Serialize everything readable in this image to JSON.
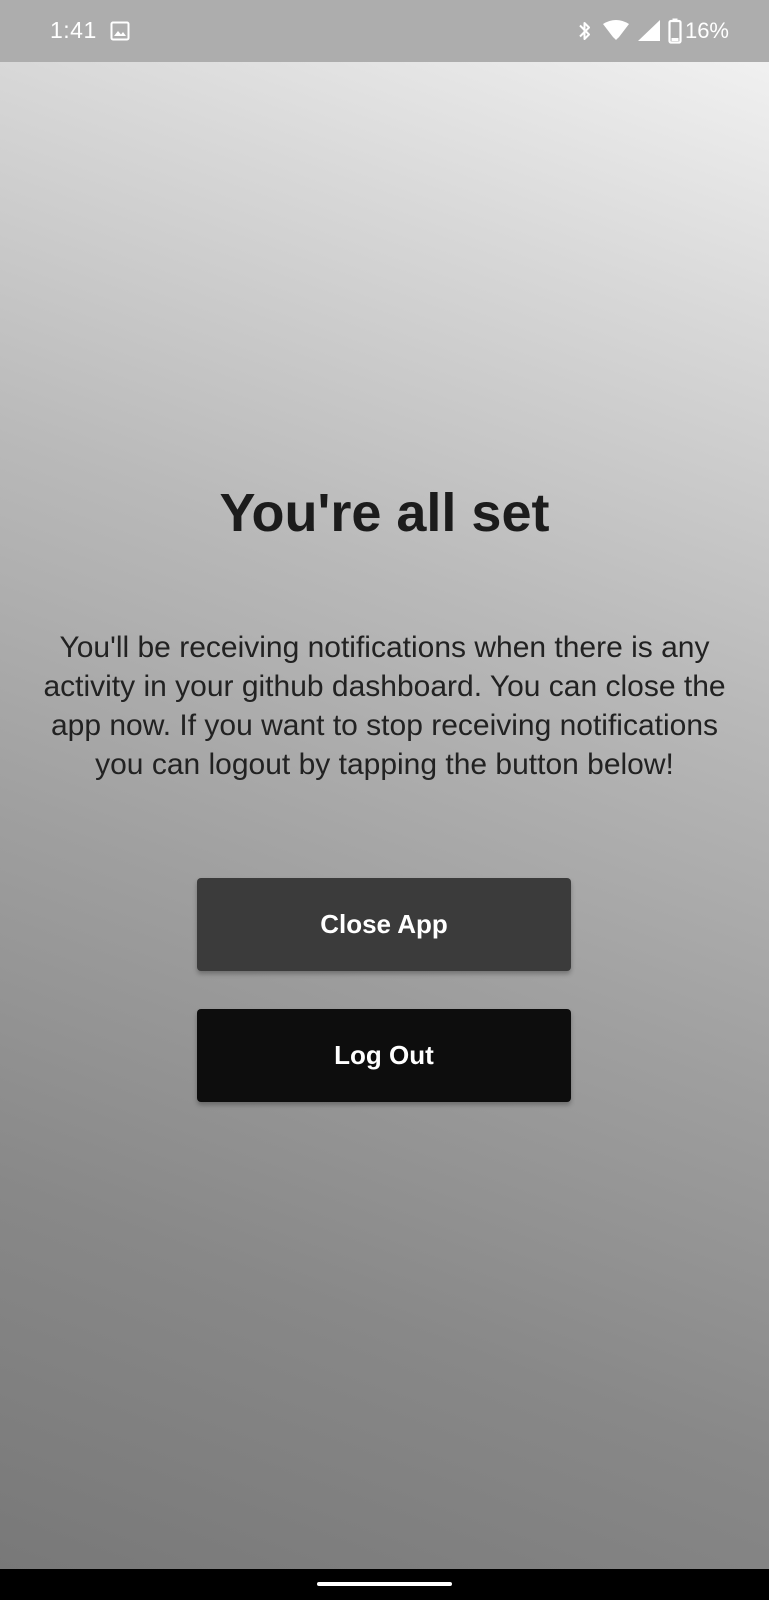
{
  "status_bar": {
    "time": "1:41",
    "battery_percent": "16%",
    "icons": [
      "gallery-icon",
      "bluetooth-icon",
      "wifi-icon",
      "signal-icon",
      "battery-icon"
    ]
  },
  "main": {
    "title": "You're all set",
    "message": "You'll be receiving notifications when there is any activity in your github dashboard. You can close the app now. If you want to stop receiving notifications you can logout by tapping the button below!",
    "close_button_label": "Close App",
    "logout_button_label": "Log Out"
  },
  "colors": {
    "close_button": "#3b3b3b",
    "logout_button": "#0d0d0d",
    "status_bar": "#adadad",
    "title_text": "#1c1c1c"
  }
}
